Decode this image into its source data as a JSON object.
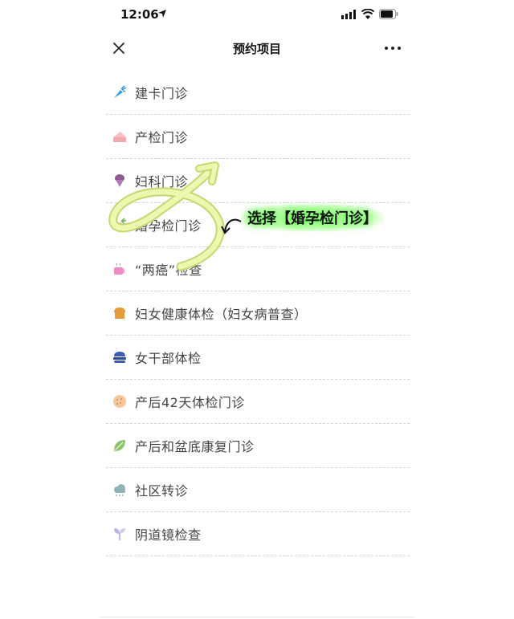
{
  "status_bar": {
    "time": "12:06"
  },
  "nav": {
    "title": "预约项目"
  },
  "items": [
    {
      "label": "建卡门诊",
      "icon": "carrot-icon",
      "color": "#3a9ad9"
    },
    {
      "label": "产检门诊",
      "icon": "cake-icon",
      "color": "#f2a9ae"
    },
    {
      "label": "妇科门诊",
      "icon": "ice-cream-icon",
      "color": "#8e5a8f"
    },
    {
      "label": "婚孕检门诊",
      "icon": "carrot-icon",
      "color": "#e07a3a"
    },
    {
      "label": "“两癌”检查",
      "icon": "coffee-cup-icon",
      "color": "#ee8bc6"
    },
    {
      "label": "妇女健康体检（妇女病普查）",
      "icon": "bread-icon",
      "color": "#e59a3c"
    },
    {
      "label": "女干部体检",
      "icon": "burger-icon",
      "color": "#3a5fb2"
    },
    {
      "label": "产后42天体检门诊",
      "icon": "cookie-icon",
      "color": "#f5c79a"
    },
    {
      "label": "产后和盆底康复门诊",
      "icon": "leaf-icon",
      "color": "#8cc36a"
    },
    {
      "label": "社区转诊",
      "icon": "cloud-icon",
      "color": "#8fb2b5"
    },
    {
      "label": "阴道镜检查",
      "icon": "sprout-icon",
      "color": "#b9b0e6"
    }
  ],
  "annotation": {
    "text": "选择【婚孕检门诊】",
    "highlight_color": "#7cff6a",
    "arrow_color": "#eef7b0"
  }
}
